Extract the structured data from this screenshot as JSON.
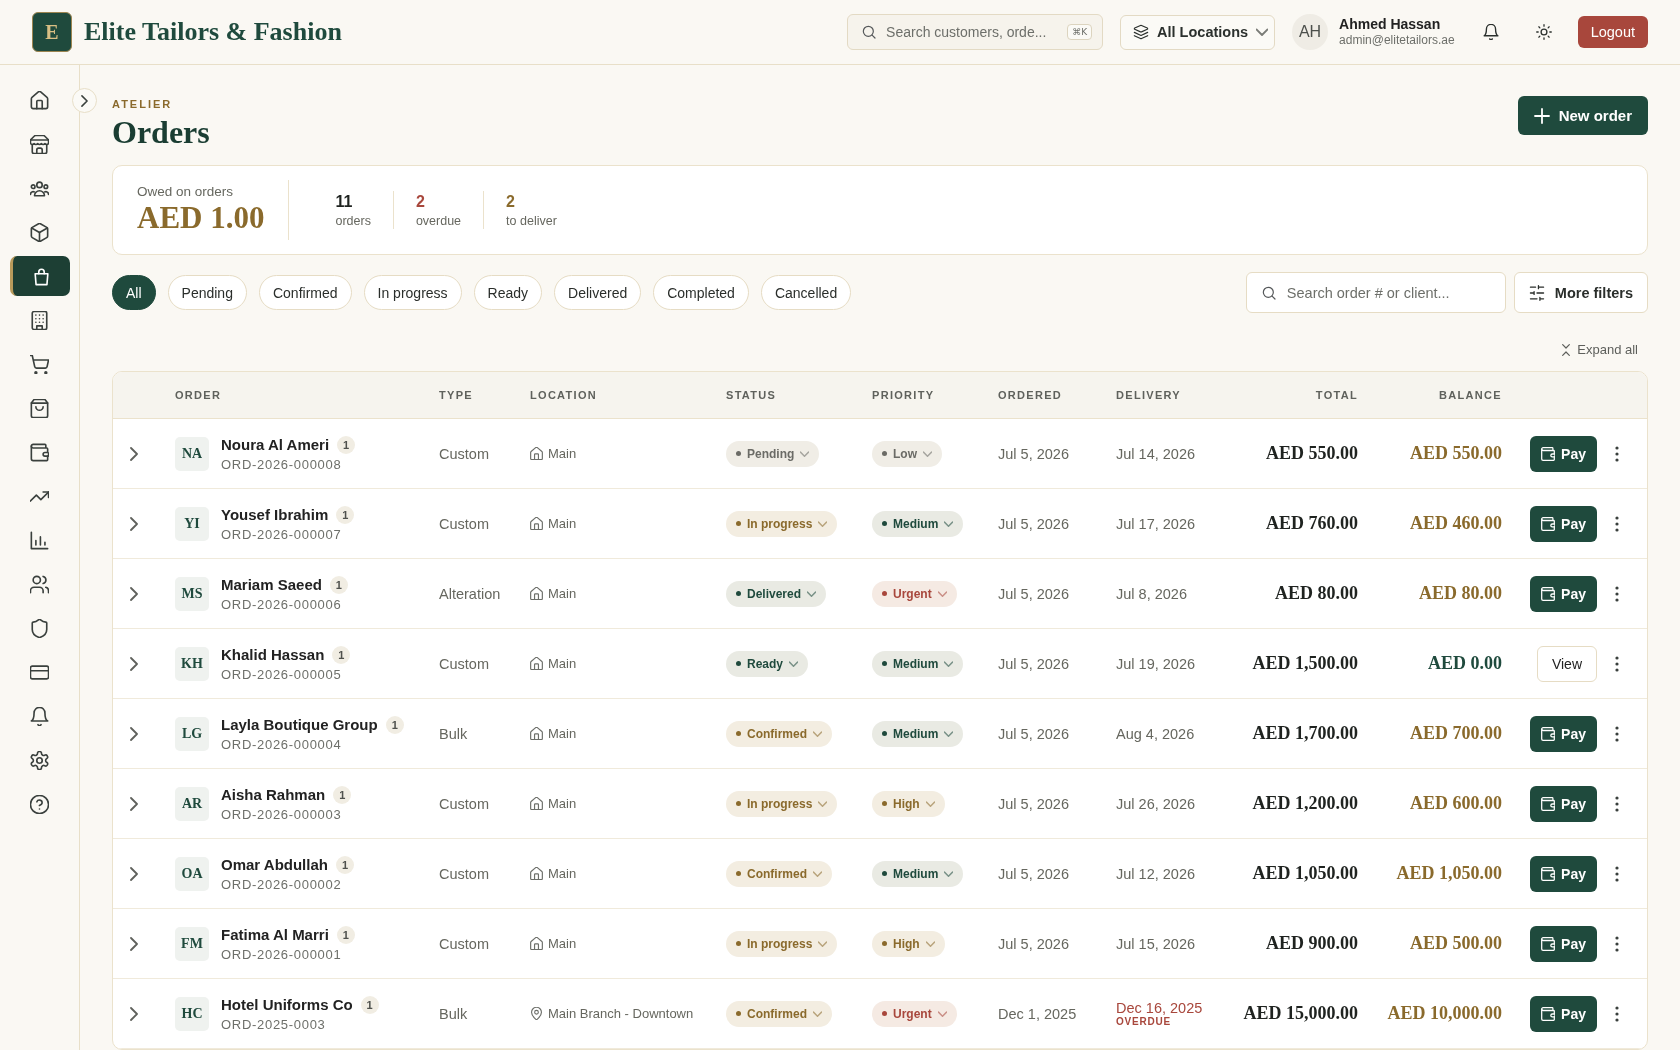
{
  "brand": {
    "logo_letter": "E",
    "name": "Elite Tailors & Fashion"
  },
  "header": {
    "search": {
      "placeholder": "Search customers, orde...",
      "shortcut": "⌘K"
    },
    "location_select": {
      "value": "All Locations"
    },
    "user": {
      "initials": "AH",
      "name": "Ahmed Hassan",
      "email": "admin@elitetailors.ae"
    },
    "logout": {
      "label": "Logout"
    }
  },
  "sidebar": {
    "items": [
      {
        "selected": false
      },
      {
        "selected": false
      },
      {
        "selected": false
      },
      {
        "selected": false
      },
      {
        "selected": true
      },
      {
        "selected": false
      },
      {
        "selected": false
      },
      {
        "selected": false
      },
      {
        "selected": false
      },
      {
        "selected": false
      },
      {
        "selected": false
      },
      {
        "selected": false
      },
      {
        "selected": false
      },
      {
        "selected": false
      },
      {
        "selected": false
      },
      {
        "selected": false
      },
      {
        "selected": false
      }
    ]
  },
  "page": {
    "eyebrow": "ATELIER",
    "title": "Orders",
    "new_order": "New order"
  },
  "summary": {
    "label": "Owed on orders",
    "amount": "AED 1.00",
    "stats": [
      {
        "value": "11",
        "label": "orders",
        "color": "#1f2320"
      },
      {
        "value": "2",
        "label": "overdue",
        "color": "#a8473c"
      },
      {
        "value": "2",
        "label": "to deliver",
        "color": "#8a6a2c"
      }
    ]
  },
  "filters": {
    "tabs": [
      {
        "label": "All",
        "selected": true
      },
      {
        "label": "Pending",
        "selected": false
      },
      {
        "label": "Confirmed",
        "selected": false
      },
      {
        "label": "In progress",
        "selected": false
      },
      {
        "label": "Ready",
        "selected": false
      },
      {
        "label": "Delivered",
        "selected": false
      },
      {
        "label": "Completed",
        "selected": false
      },
      {
        "label": "Cancelled",
        "selected": false
      }
    ],
    "search": {
      "placeholder": "Search order # or client..."
    },
    "more_filters": "More filters"
  },
  "expand_all": "Expand all",
  "table": {
    "columns": [
      "ORDER",
      "TYPE",
      "LOCATION",
      "STATUS",
      "PRIORITY",
      "ORDERED",
      "DELIVERY",
      "TOTAL",
      "BALANCE"
    ],
    "rows": [
      {
        "initials": "NA",
        "client": "Noura Al Ameri",
        "count_badge": "1",
        "order_no": "ORD-2026-000008",
        "type": "Custom",
        "location": {
          "kind": "home",
          "name": "Main"
        },
        "status": {
          "label": "Pending",
          "color": "#6b6b66"
        },
        "priority": {
          "label": "Low",
          "color": "#6b6b66"
        },
        "ordered": "Jul 5, 2026",
        "delivery": {
          "date": "Jul 14, 2026",
          "overdue": false
        },
        "total": "AED 550.00",
        "balance": {
          "amount": "AED 550.00",
          "settled": false
        },
        "action": {
          "kind": "pay",
          "label": "Pay"
        }
      },
      {
        "initials": "YI",
        "client": "Yousef Ibrahim",
        "count_badge": "1",
        "order_no": "ORD-2026-000007",
        "type": "Custom",
        "location": {
          "kind": "home",
          "name": "Main"
        },
        "status": {
          "label": "In progress",
          "color": "#8a6a2c"
        },
        "priority": {
          "label": "Medium",
          "color": "#1f4a3d"
        },
        "ordered": "Jul 5, 2026",
        "delivery": {
          "date": "Jul 17, 2026",
          "overdue": false
        },
        "total": "AED 760.00",
        "balance": {
          "amount": "AED 460.00",
          "settled": false
        },
        "action": {
          "kind": "pay",
          "label": "Pay"
        }
      },
      {
        "initials": "MS",
        "client": "Mariam Saeed",
        "count_badge": "1",
        "order_no": "ORD-2026-000006",
        "type": "Alteration",
        "location": {
          "kind": "home",
          "name": "Main"
        },
        "status": {
          "label": "Delivered",
          "color": "#1f4a3d"
        },
        "priority": {
          "label": "Urgent",
          "color": "#a8473c"
        },
        "ordered": "Jul 5, 2026",
        "delivery": {
          "date": "Jul 8, 2026",
          "overdue": false
        },
        "total": "AED 80.00",
        "balance": {
          "amount": "AED 80.00",
          "settled": false
        },
        "action": {
          "kind": "pay",
          "label": "Pay"
        }
      },
      {
        "initials": "KH",
        "client": "Khalid Hassan",
        "count_badge": "1",
        "order_no": "ORD-2026-000005",
        "type": "Custom",
        "location": {
          "kind": "home",
          "name": "Main"
        },
        "status": {
          "label": "Ready",
          "color": "#1f4a3d"
        },
        "priority": {
          "label": "Medium",
          "color": "#1f4a3d"
        },
        "ordered": "Jul 5, 2026",
        "delivery": {
          "date": "Jul 19, 2026",
          "overdue": false
        },
        "total": "AED 1,500.00",
        "balance": {
          "amount": "AED 0.00",
          "settled": true
        },
        "action": {
          "kind": "view",
          "label": "View"
        }
      },
      {
        "initials": "LG",
        "client": "Layla Boutique Group",
        "count_badge": "1",
        "order_no": "ORD-2026-000004",
        "type": "Bulk",
        "location": {
          "kind": "home",
          "name": "Main"
        },
        "status": {
          "label": "Confirmed",
          "color": "#8a6a2c"
        },
        "priority": {
          "label": "Medium",
          "color": "#1f4a3d"
        },
        "ordered": "Jul 5, 2026",
        "delivery": {
          "date": "Aug 4, 2026",
          "overdue": false
        },
        "total": "AED 1,700.00",
        "balance": {
          "amount": "AED 700.00",
          "settled": false
        },
        "action": {
          "kind": "pay",
          "label": "Pay"
        }
      },
      {
        "initials": "AR",
        "client": "Aisha Rahman",
        "count_badge": "1",
        "order_no": "ORD-2026-000003",
        "type": "Custom",
        "location": {
          "kind": "home",
          "name": "Main"
        },
        "status": {
          "label": "In progress",
          "color": "#8a6a2c"
        },
        "priority": {
          "label": "High",
          "color": "#8a6a2c"
        },
        "ordered": "Jul 5, 2026",
        "delivery": {
          "date": "Jul 26, 2026",
          "overdue": false
        },
        "total": "AED 1,200.00",
        "balance": {
          "amount": "AED 600.00",
          "settled": false
        },
        "action": {
          "kind": "pay",
          "label": "Pay"
        }
      },
      {
        "initials": "OA",
        "client": "Omar Abdullah",
        "count_badge": "1",
        "order_no": "ORD-2026-000002",
        "type": "Custom",
        "location": {
          "kind": "home",
          "name": "Main"
        },
        "status": {
          "label": "Confirmed",
          "color": "#8a6a2c"
        },
        "priority": {
          "label": "Medium",
          "color": "#1f4a3d"
        },
        "ordered": "Jul 5, 2026",
        "delivery": {
          "date": "Jul 12, 2026",
          "overdue": false
        },
        "total": "AED 1,050.00",
        "balance": {
          "amount": "AED 1,050.00",
          "settled": false
        },
        "action": {
          "kind": "pay",
          "label": "Pay"
        }
      },
      {
        "initials": "FM",
        "client": "Fatima Al Marri",
        "count_badge": "1",
        "order_no": "ORD-2026-000001",
        "type": "Custom",
        "location": {
          "kind": "home",
          "name": "Main"
        },
        "status": {
          "label": "In progress",
          "color": "#8a6a2c"
        },
        "priority": {
          "label": "High",
          "color": "#8a6a2c"
        },
        "ordered": "Jul 5, 2026",
        "delivery": {
          "date": "Jul 15, 2026",
          "overdue": false
        },
        "total": "AED 900.00",
        "balance": {
          "amount": "AED 500.00",
          "settled": false
        },
        "action": {
          "kind": "pay",
          "label": "Pay"
        }
      },
      {
        "initials": "HC",
        "client": "Hotel Uniforms Co",
        "count_badge": "1",
        "order_no": "ORD-2025-0003",
        "type": "Bulk",
        "location": {
          "kind": "pin",
          "name": "Main Branch - Downtown"
        },
        "status": {
          "label": "Confirmed",
          "color": "#8a6a2c"
        },
        "priority": {
          "label": "Urgent",
          "color": "#a8473c"
        },
        "ordered": "Dec 1, 2025",
        "delivery": {
          "date": "Dec 16, 2025",
          "overdue": true,
          "note": "OVERDUE"
        },
        "total": "AED 15,000.00",
        "balance": {
          "amount": "AED 10,000.00",
          "settled": false
        },
        "action": {
          "kind": "pay",
          "label": "Pay"
        }
      }
    ]
  }
}
